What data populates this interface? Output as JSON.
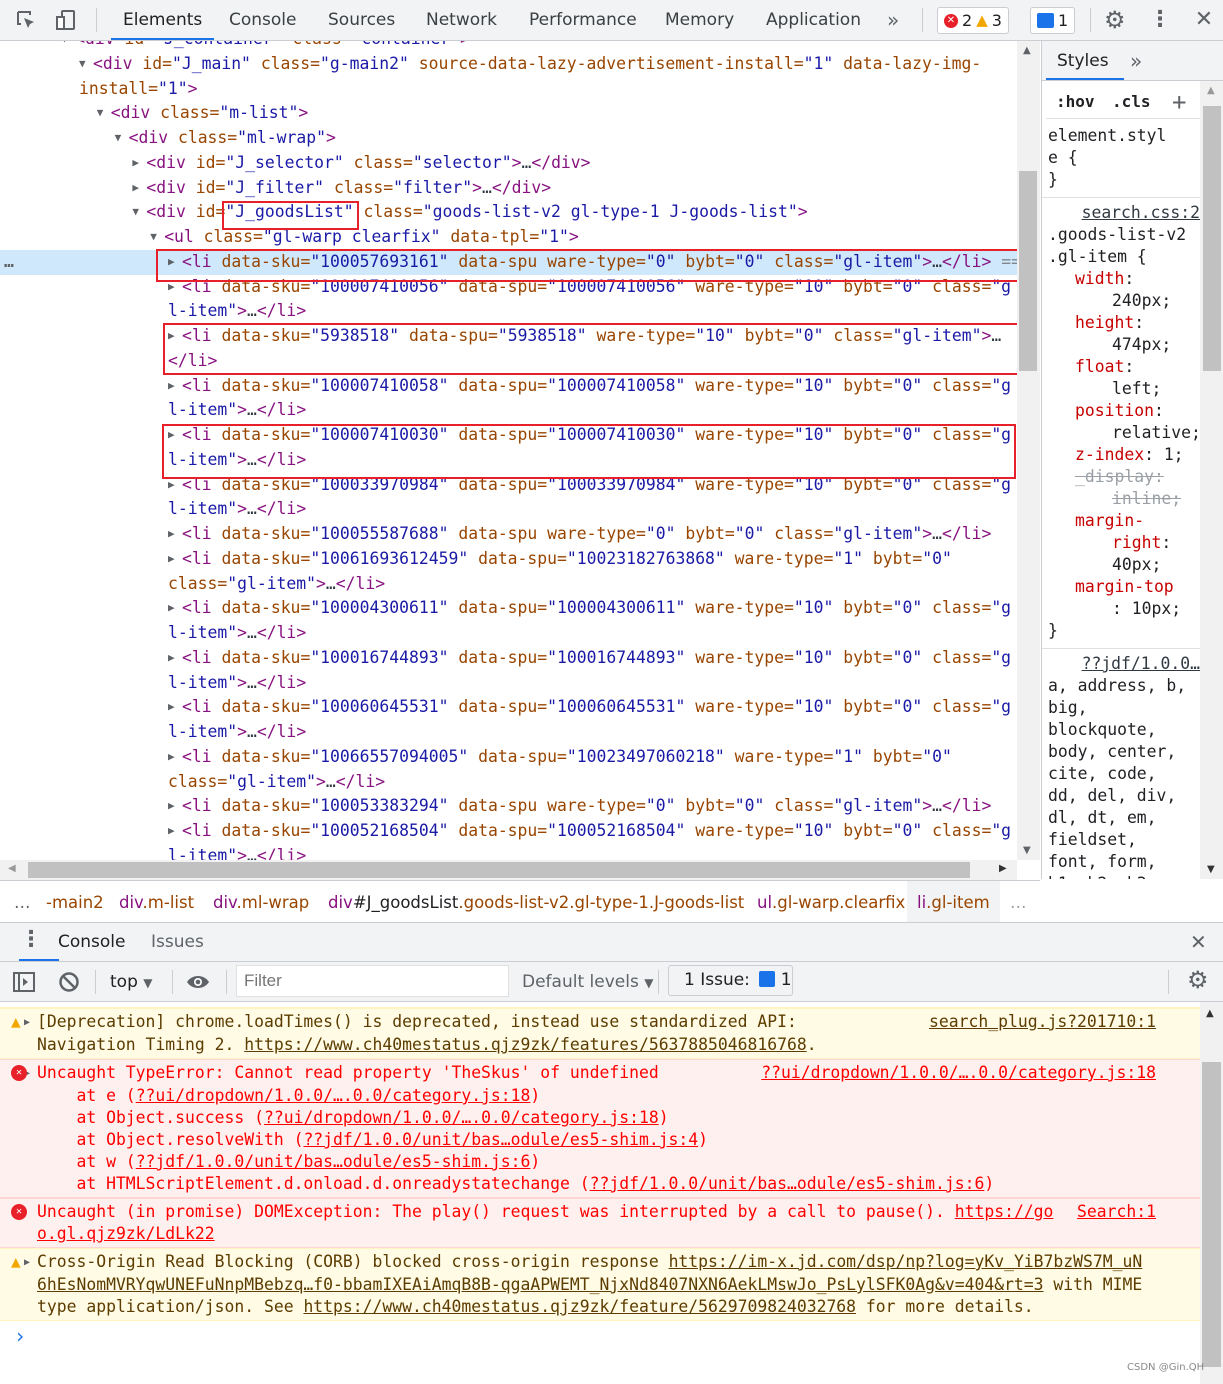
{
  "toolbar": {
    "tabs": [
      "Elements",
      "Console",
      "Sources",
      "Network",
      "Performance",
      "Memory",
      "Application"
    ],
    "active_tab": "Elements",
    "more": "»",
    "errors": "2",
    "warnings": "3",
    "issues": "1"
  },
  "elements": {
    "nodes": [
      {
        "level": -1,
        "arrow": "down",
        "text": "<div id=\"J_container\" class=\"container\">"
      },
      {
        "level": 0,
        "arrow": "down",
        "text": "<div id=\"J_main\" class=\"g-main2\" source-data-lazy-advertisement-install=\"1\" data-lazy-img-\ninstall=\"1\">"
      },
      {
        "level": 1,
        "arrow": "down",
        "text": "<div class=\"m-list\">"
      },
      {
        "level": 2,
        "arrow": "down",
        "text": "<div class=\"ml-wrap\">"
      },
      {
        "level": 3,
        "arrow": "right",
        "text": "<div id=\"J_selector\" class=\"selector\">…</div>"
      },
      {
        "level": 3,
        "arrow": "right",
        "text": "<div id=\"J_filter\" class=\"filter\">…</div>"
      },
      {
        "level": 3,
        "arrow": "down",
        "text": "<div id=\"J_goodsList\" class=\"goods-list-v2 gl-type-1 J-goods-list\">"
      },
      {
        "level": 4,
        "arrow": "down",
        "text": "<ul class=\"gl-warp clearfix\" data-tpl=\"1\">"
      },
      {
        "level": 5,
        "arrow": "right",
        "selected": true,
        "text": "<li data-sku=\"100057693161\" data-spu ware-type=\"0\" bybt=\"0\" class=\"gl-item\">…</li>",
        "suffix": " == $0"
      },
      {
        "level": 5,
        "arrow": "right",
        "text": "<li data-sku=\"100007410056\" data-spu=\"100007410056\" ware-type=\"10\" bybt=\"0\" class=\"g\nl-item\">…</li>"
      },
      {
        "level": 5,
        "arrow": "right",
        "text": "<li data-sku=\"5938518\" data-spu=\"5938518\" ware-type=\"10\" bybt=\"0\" class=\"gl-item\">…\n</li>"
      },
      {
        "level": 5,
        "arrow": "right",
        "text": "<li data-sku=\"100007410058\" data-spu=\"100007410058\" ware-type=\"10\" bybt=\"0\" class=\"g\nl-item\">…</li>"
      },
      {
        "level": 5,
        "arrow": "right",
        "text": "<li data-sku=\"100007410030\" data-spu=\"100007410030\" ware-type=\"10\" bybt=\"0\" class=\"g\nl-item\">…</li>"
      },
      {
        "level": 5,
        "arrow": "right",
        "text": "<li data-sku=\"100033970984\" data-spu=\"100033970984\" ware-type=\"10\" bybt=\"0\" class=\"g\nl-item\">…</li>"
      },
      {
        "level": 5,
        "arrow": "right",
        "text": "<li data-sku=\"100055587688\" data-spu ware-type=\"0\" bybt=\"0\" class=\"gl-item\">…</li>"
      },
      {
        "level": 5,
        "arrow": "right",
        "text": "<li data-sku=\"10061693612459\" data-spu=\"10023182763868\" ware-type=\"1\" bybt=\"0\"\nclass=\"gl-item\">…</li>"
      },
      {
        "level": 5,
        "arrow": "right",
        "text": "<li data-sku=\"100004300611\" data-spu=\"100004300611\" ware-type=\"10\" bybt=\"0\" class=\"g\nl-item\">…</li>"
      },
      {
        "level": 5,
        "arrow": "right",
        "text": "<li data-sku=\"100016744893\" data-spu=\"100016744893\" ware-type=\"10\" bybt=\"0\" class=\"g\nl-item\">…</li>"
      },
      {
        "level": 5,
        "arrow": "right",
        "text": "<li data-sku=\"100060645531\" data-spu=\"100060645531\" ware-type=\"10\" bybt=\"0\" class=\"g\nl-item\">…</li>"
      },
      {
        "level": 5,
        "arrow": "right",
        "text": "<li data-sku=\"10066557094005\" data-spu=\"10023497060218\" ware-type=\"1\" bybt=\"0\"\nclass=\"gl-item\">…</li>"
      },
      {
        "level": 5,
        "arrow": "right",
        "text": "<li data-sku=\"100053383294\" data-spu ware-type=\"0\" bybt=\"0\" class=\"gl-item\">…</li>"
      },
      {
        "level": 5,
        "arrow": "right",
        "text": "<li data-sku=\"100052168504\" data-spu=\"100052168504\" ware-type=\"10\" bybt=\"0\" class=\"g\nl-item\">…</li>"
      }
    ],
    "more_dots": "…"
  },
  "styles": {
    "tab": "Styles",
    "more": "»",
    "hov": ":hov",
    "cls": ".cls",
    "add": "+",
    "rules": [
      {
        "lines": [
          {
            "t": "element.styl"
          },
          {
            "t": "e {"
          },
          {
            "t": "}"
          }
        ]
      },
      {
        "source": "search.css:2",
        "lines": [
          {
            "t": ".goods-list-v2"
          },
          {
            "t": ".gl-item {"
          },
          {
            "p": "width",
            "sep": ":"
          },
          {
            "v": "240px;"
          },
          {
            "p": "height",
            "sep": ":"
          },
          {
            "v": "474px;"
          },
          {
            "p": "float",
            "sep": ":"
          },
          {
            "v": "left;"
          },
          {
            "p": "position",
            "sep": ":"
          },
          {
            "v": "relative;"
          },
          {
            "p": "z-index",
            "sep": ": 1;"
          },
          {
            "s": "_display:"
          },
          {
            "sv": "inline;"
          },
          {
            "p": "margin-",
            "sep": ""
          },
          {
            "p2": "right",
            "sep": ":"
          },
          {
            "v": "40px;"
          },
          {
            "p": "margin-top",
            "sep": ""
          },
          {
            "v": ": 10px;"
          },
          {
            "t": "}"
          }
        ]
      },
      {
        "source": "??jdf/1.0.0…",
        "lines": [
          {
            "t": "a, address, b,"
          },
          {
            "t": "big,"
          },
          {
            "t": "blockquote,"
          },
          {
            "t": "body, center,"
          },
          {
            "t": "cite, code,"
          },
          {
            "t": "dd, del, div,"
          },
          {
            "t": "dl, dt, em,"
          },
          {
            "t": "fieldset,"
          },
          {
            "t": "font, form,"
          },
          {
            "t": "h1, h2, h3,"
          },
          {
            "t": "h4, h5, h6,"
          }
        ]
      }
    ]
  },
  "breadcrumbs": {
    "lead": "…",
    "items": [
      {
        "tag": "",
        "rest": "-main2"
      },
      {
        "tag": "div",
        "rest": ".m-list"
      },
      {
        "tag": "div",
        "rest": ".ml-wrap"
      },
      {
        "tag": "div",
        "id": "#J_goodsList",
        "rest": ".goods-list-v2.gl-type-1.J-goods-list"
      },
      {
        "tag": "ul",
        "rest": ".gl-warp.clearfix"
      },
      {
        "tag": "li",
        "rest": ".gl-item"
      }
    ],
    "trail": "…"
  },
  "drawer": {
    "tabs": [
      "Console",
      "Issues"
    ],
    "active_tab": "Console"
  },
  "console_toolbar": {
    "context": "top",
    "filter_placeholder": "Filter",
    "levels": "Default levels",
    "issues_label": "1 Issue:",
    "issues_count": "1"
  },
  "console": {
    "messages": [
      {
        "level": "warn",
        "expandable": true,
        "location": "search_plug.js?201710:1",
        "lines": [
          [
            {
              "t": "[Deprecation] chrome.loadTimes() is deprecated, instead use standardized API:"
            }
          ],
          [
            {
              "t": "Navigation Timing 2. "
            },
            {
              "l": "https://www.ch40mestatus.qjz9zk/features/5637885046816768"
            },
            {
              "t": "."
            }
          ]
        ]
      },
      {
        "level": "err",
        "expandable": true,
        "location": "??ui/dropdown/1.0.0/….0.0/category.js:18",
        "lines": [
          [
            {
              "t": "Uncaught TypeError: Cannot read property 'TheSkus' of undefined"
            }
          ],
          [
            {
              "t": "    at e ("
            },
            {
              "l": "??ui/dropdown/1.0.0/….0.0/category.js:18"
            },
            {
              "t": ")"
            }
          ],
          [
            {
              "t": "    at Object.success ("
            },
            {
              "l": "??ui/dropdown/1.0.0/….0.0/category.js:18"
            },
            {
              "t": ")"
            }
          ],
          [
            {
              "t": "    at Object.resolveWith ("
            },
            {
              "l": "??jdf/1.0.0/unit/bas…odule/es5-shim.js:4"
            },
            {
              "t": ")"
            }
          ],
          [
            {
              "t": "    at w ("
            },
            {
              "l": "??jdf/1.0.0/unit/bas…odule/es5-shim.js:6"
            },
            {
              "t": ")"
            }
          ],
          [
            {
              "t": "    at HTMLScriptElement.d.onload.d.onreadystatechange ("
            },
            {
              "l": "??jdf/1.0.0/unit/bas…odule/es5-shim.js:6"
            },
            {
              "t": ")"
            }
          ]
        ]
      },
      {
        "level": "err",
        "expandable": false,
        "location": "Search:1",
        "lines": [
          [
            {
              "t": "Uncaught (in promise) DOMException: The play() request was interrupted by a call to pause(). "
            },
            {
              "l": "https://go"
            }
          ],
          [
            {
              "l": "o.gl.qjz9zk/LdLk22"
            }
          ]
        ]
      },
      {
        "level": "warn",
        "expandable": true,
        "lines": [
          [
            {
              "t": "Cross-Origin Read Blocking (CORB) blocked cross-origin response "
            },
            {
              "l": "https://im-x.jd.com/dsp/np?log=yKv_YiB7bzWS7M_uN"
            }
          ],
          [
            {
              "l": "6hEsNomMVRYqwUNEFuNnpMBebzq…f0-bbamIXEAiAmqB8B-qgaAPWEMT_NjxNd8407NXN6AekLMswJo_PsLylSFK0Ag&v=404&rt=3"
            },
            {
              "t": " with MIME"
            }
          ],
          [
            {
              "t": "type application/json. See "
            },
            {
              "l": "https://www.ch40mestatus.qjz9zk/feature/5629709824032768"
            },
            {
              "t": " for more details."
            }
          ]
        ]
      }
    ],
    "prompt": "›"
  },
  "watermark": "CSDN @Gin.QH",
  "colors": {
    "accent": "#1a73e8",
    "error": "#ff0000",
    "warning_bg": "#fffbe5",
    "error_bg": "#fff0f0",
    "selection": "#cfe8fc",
    "annotation": "#e8202a"
  }
}
